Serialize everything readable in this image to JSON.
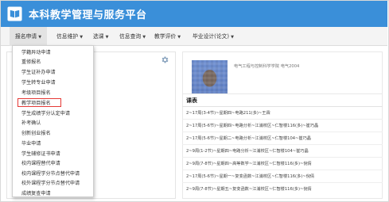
{
  "app": {
    "title": "本科教学管理与服务平台"
  },
  "nav": {
    "items": [
      {
        "label": "报名申请"
      },
      {
        "label": "信息维护"
      },
      {
        "label": "选课"
      },
      {
        "label": "信息查询"
      },
      {
        "label": "教学评价"
      },
      {
        "label": "毕业设计(论文)"
      }
    ]
  },
  "dropdown": {
    "items": [
      "学籍异动申请",
      "重修报名",
      "学生证补办申请",
      "学生转专业申请",
      "考级项目报名",
      "教学项目报名",
      "学生成绩学分认定申请",
      "补考确认",
      "创新创业报名",
      "毕业申请",
      "学生辅修证书申请",
      "校内课程替代申请",
      "校内课程学分节点替代申请",
      "校外课程学分节点替代申请",
      "成绩复查申请"
    ],
    "highlighted": "教学项目报名"
  },
  "profile": {
    "info": "电气工程与控制科学学院 电气2004"
  },
  "schedule": {
    "title": "课表",
    "courses": [
      "2~17周(3-4节)~星期四~电路211(多)~王霖",
      "2~17周(5-6节)~星期四~电路分析~江浦校区~仁智楼116(多)~崔巧晶",
      "2~17周(5-6节)~星期二~电路分析~江浦校区~仁智楼104~崔巧晶",
      "2~9周(1-2节)~星期四~电路分析~江浦校区~仁智楼104~崔巧晶",
      "2~9周(7-8节)~星期四~高等数学~江浦校区~仁智楼116(多)~倪倩",
      "2~17周(5-6节)~星期一~复变函数~江浦校区~仁智楼116(多)~倪倩",
      "2~9周(7-8节)~星期五~复变函数~江浦校区~仁智楼116(多)~倪倩"
    ]
  },
  "colors": {
    "header": "#3a8fd9",
    "highlight": "#e53935"
  },
  "icons": {
    "logo": "book-logo-icon",
    "settings": "gear-icon"
  }
}
